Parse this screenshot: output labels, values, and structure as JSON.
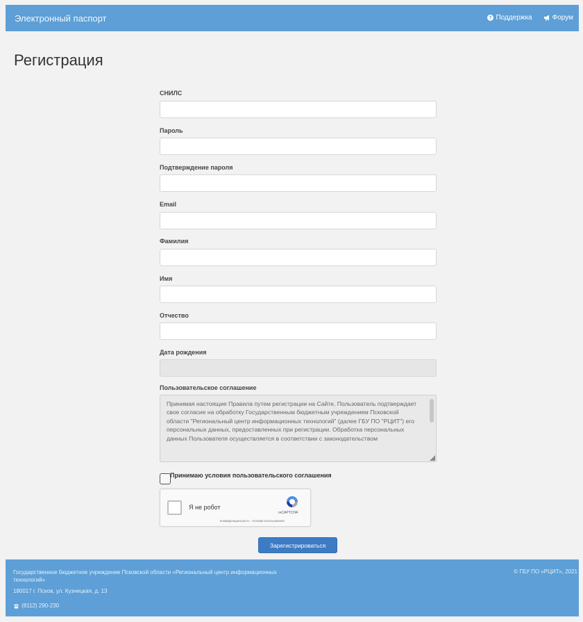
{
  "header": {
    "brand": "Электронный паспорт",
    "links": [
      {
        "label": "Поддержка",
        "icon": "question-circle-icon"
      },
      {
        "label": "Форум",
        "icon": "bullhorn-icon"
      }
    ]
  },
  "page": {
    "title": "Регистрация"
  },
  "form": {
    "fields": [
      {
        "label": "СНИЛС",
        "value": ""
      },
      {
        "label": "Пароль",
        "value": ""
      },
      {
        "label": "Подтверждение пароля",
        "value": ""
      },
      {
        "label": "Email",
        "value": ""
      },
      {
        "label": "Фамилия",
        "value": ""
      },
      {
        "label": "Имя",
        "value": ""
      },
      {
        "label": "Отчество",
        "value": ""
      },
      {
        "label": "Дата рождения",
        "value": "",
        "disabled": true
      }
    ],
    "agreement": {
      "label": "Пользовательское соглашение",
      "text": "Принимая настоящие Правила путем регистрации на Сайте, Пользователь подтверждает свое согласие на обработку Государственным бюджетным учреждением Псковской области \"Региональный центр информационных технологий\" (далее ГБУ ПО \"РЦИТ\") его персональных данных, предоставленных при регистрации. Обработка персональных данных Пользователя осуществляется в соответствии с законодательством"
    },
    "accept_label": "Принимаю условия пользовательского соглашения",
    "accept_checked": false,
    "captcha": {
      "label": "Я не робот",
      "brand": "reCAPTCHA",
      "links": "Конфиденциальность - Условия использования"
    },
    "submit_label": "Зарегистрироваться"
  },
  "footer": {
    "org": "Государственное бюджетное учреждение Псковской области «Региональный центр информационных технологий»",
    "address": "180017 г. Псков, ул. Кузнецкая, д. 13",
    "phone": "(8112) 290-230",
    "copyright": "© ГБУ ПО «РЦИТ», 2021"
  },
  "colors": {
    "header_bg": "#5d9fd6",
    "page_bg": "#f2f2f2",
    "button_bg": "#3d7cc4"
  }
}
